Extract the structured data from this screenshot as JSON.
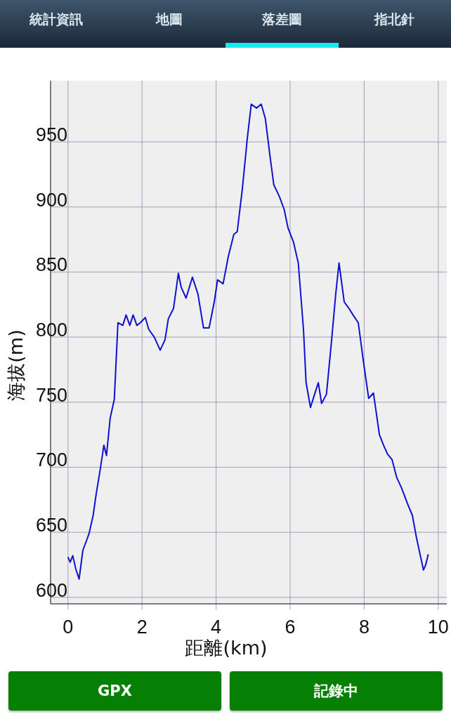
{
  "tabs": [
    {
      "label": "統計資訊",
      "selected": false
    },
    {
      "label": "地圖",
      "selected": false
    },
    {
      "label": "落差圖",
      "selected": true
    },
    {
      "label": "指北針",
      "selected": false
    }
  ],
  "elevation_chart": {
    "chart_data": {
      "type": "line",
      "xlabel": "距離(km)",
      "ylabel": "海拔(m)",
      "xlim": [
        -0.47,
        10.23
      ],
      "ylim": [
        595,
        997
      ],
      "xticks": [
        0,
        2,
        4,
        6,
        8,
        10
      ],
      "yticks": [
        600,
        650,
        700,
        750,
        800,
        850,
        900,
        950
      ],
      "x": [
        0,
        0.06,
        0.13,
        0.21,
        0.3,
        0.4,
        0.57,
        0.68,
        0.76,
        0.87,
        0.97,
        1.04,
        1.14,
        1.25,
        1.35,
        1.48,
        1.57,
        1.67,
        1.76,
        1.86,
        1.95,
        2.09,
        2.18,
        2.33,
        2.49,
        2.62,
        2.71,
        2.85,
        2.98,
        3.06,
        3.19,
        3.36,
        3.51,
        3.66,
        3.81,
        3.95,
        4.04,
        4.19,
        4.33,
        4.48,
        4.57,
        4.71,
        4.84,
        4.95,
        5.09,
        5.22,
        5.33,
        5.46,
        5.56,
        5.71,
        5.84,
        5.94,
        6.09,
        6.22,
        6.36,
        6.43,
        6.55,
        6.66,
        6.76,
        6.85,
        6.98,
        7.12,
        7.23,
        7.32,
        7.46,
        7.59,
        7.7,
        7.84,
        7.99,
        8.12,
        8.25,
        8.41,
        8.52,
        8.63,
        8.75,
        8.88,
        9.01,
        9.17,
        9.3,
        9.41,
        9.51,
        9.6,
        9.66,
        9.73
      ],
      "grid": true,
      "series": [
        {
          "color": "#1010d0",
          "values": [
            631,
            627,
            632,
            622,
            614,
            636,
            649,
            663,
            679,
            698,
            717,
            709,
            738,
            752,
            811,
            809,
            817,
            809,
            817,
            809,
            811,
            815,
            806,
            800,
            790,
            798,
            814,
            822,
            849,
            838,
            830,
            846,
            833,
            807,
            807,
            827,
            844,
            841,
            862,
            879,
            881,
            914,
            952,
            979,
            976,
            979,
            968,
            938,
            917,
            908,
            898,
            884,
            873,
            857,
            806,
            765,
            746,
            756,
            765,
            749,
            756,
            798,
            833,
            857,
            827,
            822,
            817,
            811,
            779,
            753,
            757,
            725,
            717,
            710,
            706,
            692,
            684,
            672,
            663,
            646,
            633,
            621,
            625,
            633
          ]
        }
      ]
    }
  },
  "buttons": [
    {
      "label": "GPX"
    },
    {
      "label": "記錄中"
    }
  ]
}
